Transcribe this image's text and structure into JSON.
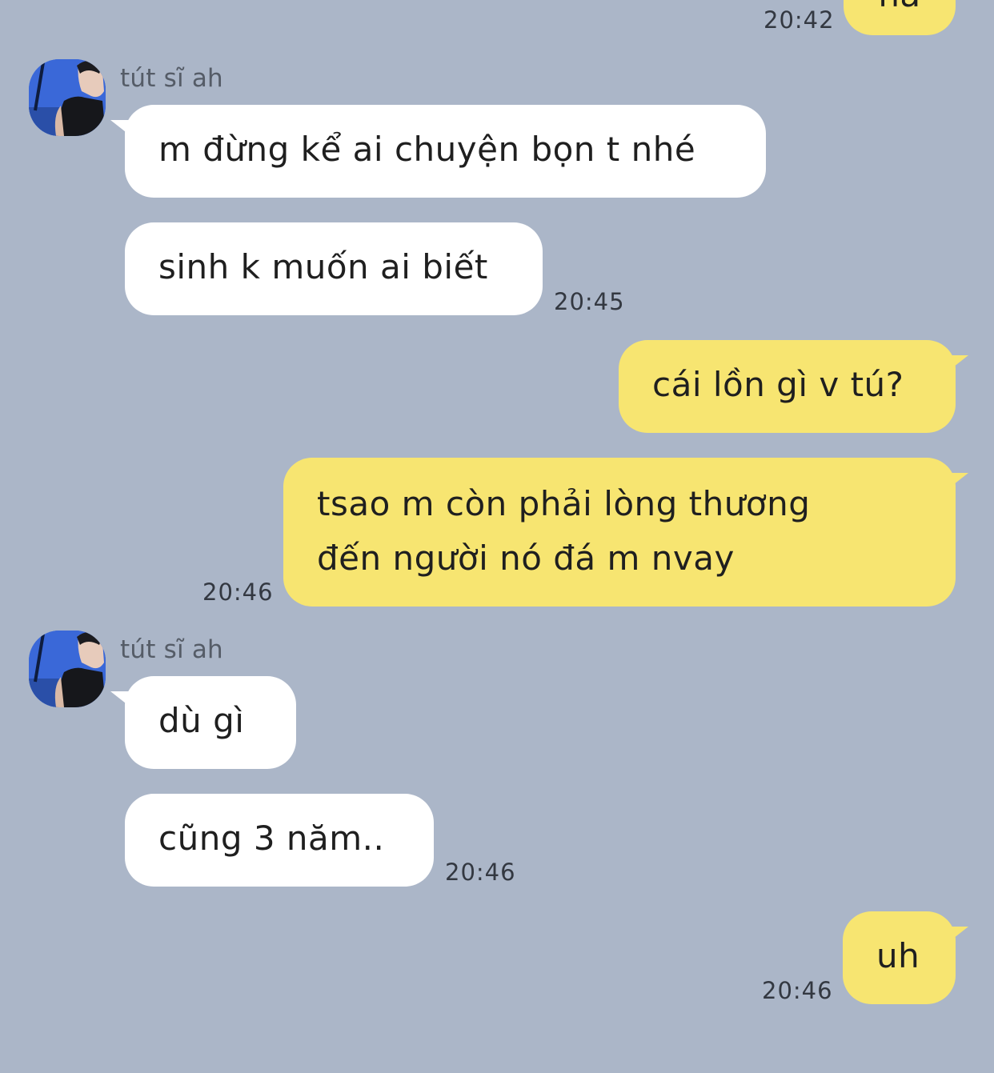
{
  "colors": {
    "background": "#abb6c8",
    "incoming_bubble": "#ffffff",
    "outgoing_bubble": "#f7e571"
  },
  "messages": {
    "m0": {
      "text": "hả",
      "time": "20:42"
    },
    "sender_1": "tút sĩ ah",
    "m1": {
      "text": "m đừng kể ai chuyện bọn t nhé"
    },
    "m2": {
      "text": "sinh k muốn ai biết",
      "time": "20:45"
    },
    "m3": {
      "text": "cái lồn gì v tú?"
    },
    "m4": {
      "line1": "tsao m còn phải lòng thương",
      "line2": "đến người nó đá m nvay",
      "time": "20:46"
    },
    "sender_2": "tút sĩ ah",
    "m5": {
      "text": "dù gì"
    },
    "m6": {
      "text": "cũng 3 năm..",
      "time": "20:46"
    },
    "m7": {
      "text": "uh",
      "time": "20:46"
    }
  },
  "icons": {
    "avatar": "profile-photo-avatar"
  }
}
